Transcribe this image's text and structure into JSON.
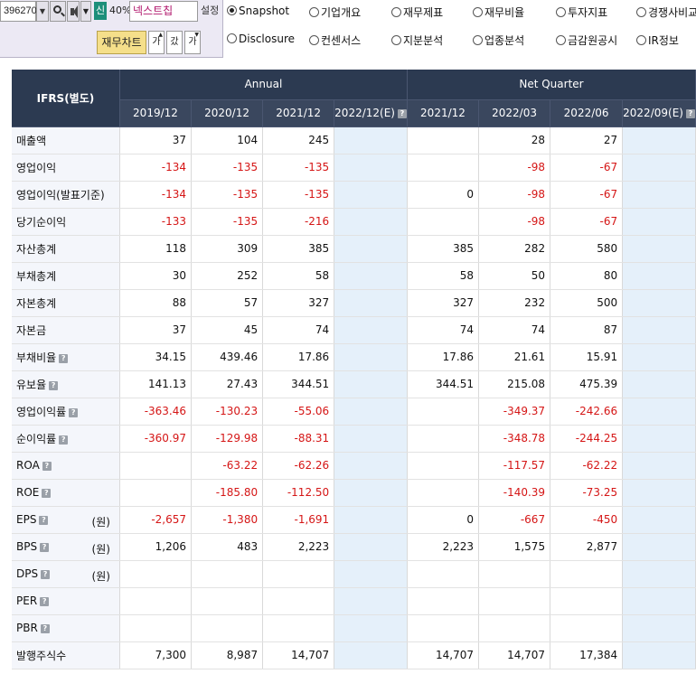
{
  "toolbar": {
    "stock_code": "396270",
    "new_badge": "신",
    "percent": "40%",
    "stock_name": "넥스트칩",
    "settings_label": "설정",
    "chart_button": "재무차트",
    "font_btn_1": "가",
    "font_btn_2": "갔",
    "font_btn_3": "가"
  },
  "radios": [
    {
      "label": "Snapshot",
      "checked": true
    },
    {
      "label": "기업개요",
      "checked": false
    },
    {
      "label": "재무제표",
      "checked": false
    },
    {
      "label": "재무비율",
      "checked": false
    },
    {
      "label": "투자지표",
      "checked": false
    },
    {
      "label": "경쟁사비교",
      "checked": false
    },
    {
      "label": "Disclosure",
      "checked": false
    },
    {
      "label": "컨센서스",
      "checked": false
    },
    {
      "label": "지분분석",
      "checked": false
    },
    {
      "label": "업종분석",
      "checked": false
    },
    {
      "label": "금감원공시",
      "checked": false
    },
    {
      "label": "IR정보",
      "checked": false
    }
  ],
  "table": {
    "corner": "IFRS(별도)",
    "group_annual": "Annual",
    "group_quarter": "Net Quarter",
    "columns": [
      "2019/12",
      "2020/12",
      "2021/12",
      "2022/12(E)",
      "2021/12",
      "2022/03",
      "2022/06",
      "2022/09(E)"
    ],
    "help_icon": "?",
    "rows": [
      {
        "label": "매출액",
        "help": false,
        "unit": "",
        "values": [
          "37",
          "104",
          "245",
          "",
          "",
          "28",
          "27",
          ""
        ]
      },
      {
        "label": "영업이익",
        "help": false,
        "unit": "",
        "values": [
          "-134",
          "-135",
          "-135",
          "",
          "",
          "-98",
          "-67",
          ""
        ]
      },
      {
        "label": "영업이익(발표기준)",
        "help": false,
        "unit": "",
        "values": [
          "-134",
          "-135",
          "-135",
          "",
          "0",
          "-98",
          "-67",
          ""
        ]
      },
      {
        "label": "당기순이익",
        "help": false,
        "unit": "",
        "values": [
          "-133",
          "-135",
          "-216",
          "",
          "",
          "-98",
          "-67",
          ""
        ]
      },
      {
        "label": "자산총계",
        "help": false,
        "unit": "",
        "values": [
          "118",
          "309",
          "385",
          "",
          "385",
          "282",
          "580",
          ""
        ]
      },
      {
        "label": "부채총계",
        "help": false,
        "unit": "",
        "values": [
          "30",
          "252",
          "58",
          "",
          "58",
          "50",
          "80",
          ""
        ]
      },
      {
        "label": "자본총계",
        "help": false,
        "unit": "",
        "values": [
          "88",
          "57",
          "327",
          "",
          "327",
          "232",
          "500",
          ""
        ]
      },
      {
        "label": "자본금",
        "help": false,
        "unit": "",
        "values": [
          "37",
          "45",
          "74",
          "",
          "74",
          "74",
          "87",
          ""
        ]
      },
      {
        "label": "부채비율",
        "help": true,
        "unit": "",
        "values": [
          "34.15",
          "439.46",
          "17.86",
          "",
          "17.86",
          "21.61",
          "15.91",
          ""
        ]
      },
      {
        "label": "유보율",
        "help": true,
        "unit": "",
        "values": [
          "141.13",
          "27.43",
          "344.51",
          "",
          "344.51",
          "215.08",
          "475.39",
          ""
        ]
      },
      {
        "label": "영업이익률",
        "help": true,
        "unit": "",
        "values": [
          "-363.46",
          "-130.23",
          "-55.06",
          "",
          "",
          "-349.37",
          "-242.66",
          ""
        ]
      },
      {
        "label": "순이익률",
        "help": true,
        "unit": "",
        "values": [
          "-360.97",
          "-129.98",
          "-88.31",
          "",
          "",
          "-348.78",
          "-244.25",
          ""
        ]
      },
      {
        "label": "ROA",
        "help": true,
        "unit": "",
        "values": [
          "",
          "-63.22",
          "-62.26",
          "",
          "",
          "-117.57",
          "-62.22",
          ""
        ]
      },
      {
        "label": "ROE",
        "help": true,
        "unit": "",
        "values": [
          "",
          "-185.80",
          "-112.50",
          "",
          "",
          "-140.39",
          "-73.25",
          ""
        ]
      },
      {
        "label": "EPS",
        "help": true,
        "unit": "(원)",
        "values": [
          "-2,657",
          "-1,380",
          "-1,691",
          "",
          "0",
          "-667",
          "-450",
          ""
        ]
      },
      {
        "label": "BPS",
        "help": true,
        "unit": "(원)",
        "values": [
          "1,206",
          "483",
          "2,223",
          "",
          "2,223",
          "1,575",
          "2,877",
          ""
        ]
      },
      {
        "label": "DPS",
        "help": true,
        "unit": "(원)",
        "values": [
          "",
          "",
          "",
          "",
          "",
          "",
          "",
          ""
        ]
      },
      {
        "label": "PER",
        "help": true,
        "unit": "",
        "values": [
          "",
          "",
          "",
          "",
          "",
          "",
          "",
          ""
        ]
      },
      {
        "label": "PBR",
        "help": true,
        "unit": "",
        "values": [
          "",
          "",
          "",
          "",
          "",
          "",
          "",
          ""
        ]
      },
      {
        "label": "발행주식수",
        "help": false,
        "unit": "",
        "values": [
          "7,300",
          "8,987",
          "14,707",
          "",
          "14,707",
          "14,707",
          "17,384",
          ""
        ]
      }
    ]
  }
}
